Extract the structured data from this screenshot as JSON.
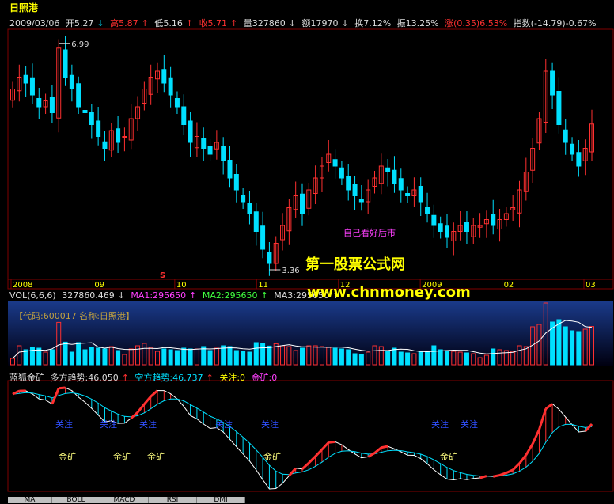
{
  "header": {
    "title": "日照港",
    "date": "2009/03/06",
    "open": "开5.27",
    "high": "高5.87",
    "low": "低5.16",
    "close": "收5.71",
    "volume": "量327860",
    "amount": "额17970",
    "turnover": "换7.12%",
    "amplitude": "振13.25%",
    "change": "涨(0.35)6.53%",
    "index": "指数(-14.79)-0.67%"
  },
  "colors": {
    "up": "#ff3030",
    "down": "#00e0ff",
    "grid": "#800000",
    "vol_bg_top": "#1a3a8a",
    "white_line": "#ffffff",
    "yellow": "#ffff00",
    "magenta": "#ff40ff",
    "green": "#40ff40"
  },
  "annotations": {
    "max_label": "6.99",
    "min_label": "3.36",
    "note": "自己看好后市",
    "watermark1": "第一股票公式网",
    "watermark2": "www.chnmoney.com",
    "s_mark": "S"
  },
  "x_axis": {
    "labels": [
      "2008",
      "09",
      "10",
      "11",
      "12",
      "2009",
      "02",
      "03"
    ]
  },
  "volume": {
    "label": "VOL(6,6,6)",
    "value": "327860.469",
    "ma1": "MA1:295650",
    "ma2": "MA2:295650",
    "ma3": "MA3:295650",
    "code_label": "【代码:600017 名称:日照港】"
  },
  "indicator": {
    "name": "蓝狐金矿",
    "long_trend": "多方趋势:46.050",
    "short_trend": "空方趋势:46.737",
    "attention": "关注:0",
    "gold": "金矿:0",
    "signal_attention": "关注",
    "signal_gold": "金矿"
  },
  "tabs": [
    "MA",
    "BOLL",
    "MACD",
    "RSI",
    "DMI"
  ],
  "chart_data": {
    "type": "candlestick",
    "title": "日照港",
    "max": 6.99,
    "min": 3.36,
    "ylim": [
      3.2,
      7.2
    ],
    "closes": [
      6.3,
      6.5,
      6.4,
      6.2,
      6.0,
      6.1,
      5.9,
      6.99,
      6.5,
      6.3,
      6.0,
      5.9,
      5.7,
      5.5,
      5.3,
      5.6,
      5.4,
      5.5,
      5.8,
      6.0,
      6.3,
      6.5,
      6.6,
      6.4,
      6.2,
      6.0,
      5.7,
      5.4,
      5.5,
      5.3,
      5.2,
      5.4,
      5.1,
      4.8,
      4.6,
      4.4,
      4.2,
      3.9,
      3.6,
      3.36,
      3.7,
      4.0,
      4.3,
      4.5,
      4.2,
      4.6,
      4.8,
      5.0,
      5.2,
      5.0,
      4.8,
      4.6,
      4.5,
      4.4,
      4.6,
      4.8,
      5.0,
      4.9,
      4.7,
      4.6,
      4.5,
      4.6,
      4.4,
      4.2,
      4.0,
      3.9,
      3.8,
      3.9,
      4.0,
      3.9,
      4.0,
      4.0,
      4.1,
      4.0,
      4.1,
      4.2,
      4.3,
      4.6,
      4.9,
      5.3,
      5.8,
      6.6,
      6.2,
      5.7,
      5.4,
      5.2,
      5.0,
      5.3,
      5.71
    ]
  }
}
